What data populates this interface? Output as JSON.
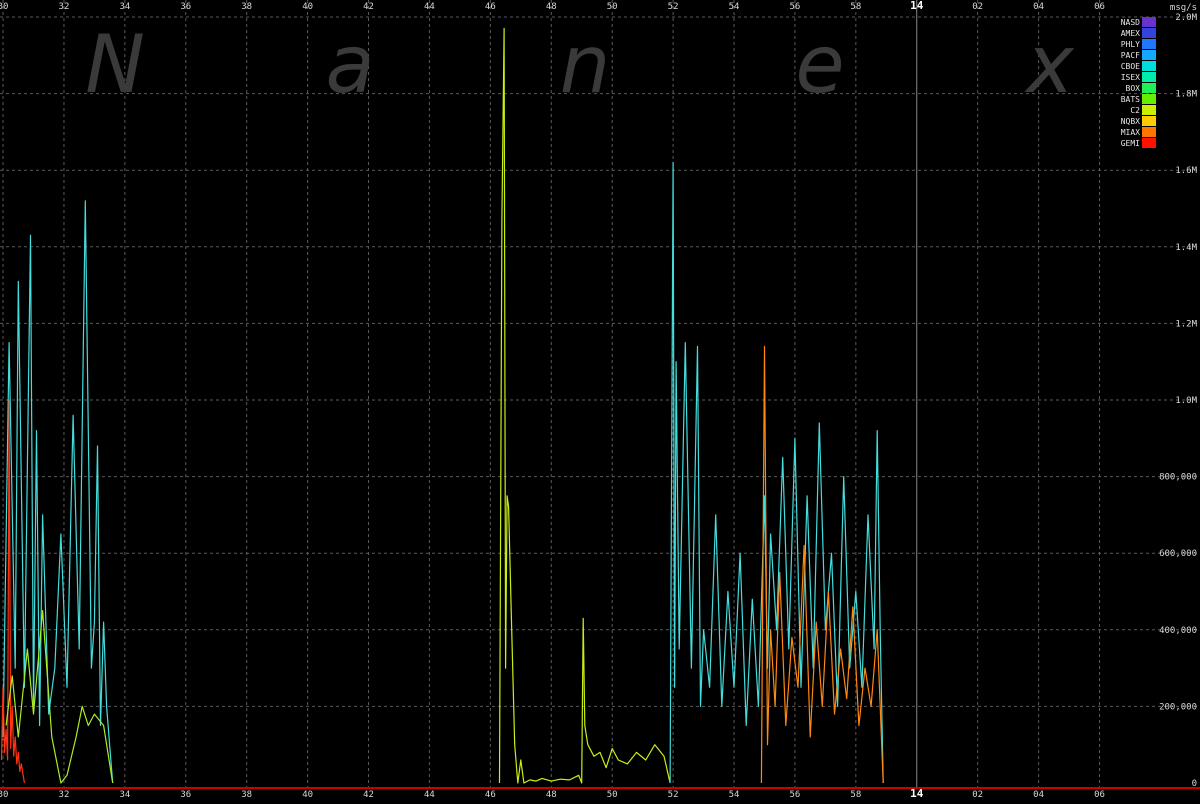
{
  "watermark": [
    "N",
    "a",
    "n",
    "e",
    "x"
  ],
  "chart_data": {
    "type": "line",
    "title": "",
    "xlabel": "",
    "ylabel": "msg/s",
    "xlim": [
      29.9,
      69.3
    ],
    "ylim": [
      0,
      2000000
    ],
    "grid": true,
    "legend_position": "top-right",
    "x_ticks": [
      {
        "value": 30,
        "label": "30"
      },
      {
        "value": 32,
        "label": "32"
      },
      {
        "value": 34,
        "label": "34"
      },
      {
        "value": 36,
        "label": "36"
      },
      {
        "value": 38,
        "label": "38"
      },
      {
        "value": 40,
        "label": "40"
      },
      {
        "value": 42,
        "label": "42"
      },
      {
        "value": 44,
        "label": "44"
      },
      {
        "value": 46,
        "label": "46"
      },
      {
        "value": 48,
        "label": "48"
      },
      {
        "value": 50,
        "label": "50"
      },
      {
        "value": 52,
        "label": "52"
      },
      {
        "value": 54,
        "label": "54"
      },
      {
        "value": 56,
        "label": "56"
      },
      {
        "value": 58,
        "label": "58"
      },
      {
        "value": 60,
        "label": "14",
        "hour": true
      },
      {
        "value": 62,
        "label": "02"
      },
      {
        "value": 64,
        "label": "04"
      },
      {
        "value": 66,
        "label": "06"
      }
    ],
    "y_ticks": [
      {
        "value": 0,
        "label": "0"
      },
      {
        "value": 200000,
        "label": "200,000"
      },
      {
        "value": 400000,
        "label": "400,000"
      },
      {
        "value": 600000,
        "label": "600,000"
      },
      {
        "value": 800000,
        "label": "800,000"
      },
      {
        "value": 1000000,
        "label": "1.0M"
      },
      {
        "value": 1200000,
        "label": "1.2M"
      },
      {
        "value": 1400000,
        "label": "1.4M"
      },
      {
        "value": 1600000,
        "label": "1.6M"
      },
      {
        "value": 1800000,
        "label": "1.8M"
      },
      {
        "value": 2000000,
        "label": "2.0M"
      }
    ],
    "legend": [
      {
        "name": "NASD",
        "color": "#6633cc"
      },
      {
        "name": "AMEX",
        "color": "#3344dd"
      },
      {
        "name": "PHLY",
        "color": "#2277ff"
      },
      {
        "name": "PACF",
        "color": "#11aaff"
      },
      {
        "name": "CBOE",
        "color": "#00dddd"
      },
      {
        "name": "ISEX",
        "color": "#00eeaa"
      },
      {
        "name": "BOX",
        "color": "#22ee55"
      },
      {
        "name": "BATS",
        "color": "#66ee00"
      },
      {
        "name": "C2",
        "color": "#ccee00"
      },
      {
        "name": "NQBX",
        "color": "#ffcc00"
      },
      {
        "name": "MIAX",
        "color": "#ff7700"
      },
      {
        "name": "GEMI",
        "color": "#ff1100"
      }
    ],
    "series": [
      {
        "color": "#44dddd",
        "x": [
          30.0,
          30.2,
          30.4,
          30.5,
          30.7,
          30.9,
          31.0,
          31.1,
          31.2,
          31.3,
          31.5,
          31.7,
          31.9,
          32.1,
          32.3,
          32.5,
          32.7,
          32.9,
          33.0,
          33.1,
          33.2,
          33.3,
          33.4,
          33.5,
          33.6
        ],
        "values": [
          120000,
          1150000,
          300000,
          1310000,
          250000,
          1430000,
          200000,
          920000,
          150000,
          700000,
          180000,
          300000,
          650000,
          250000,
          960000,
          350000,
          1520000,
          300000,
          420000,
          880000,
          150000,
          420000,
          200000,
          100000,
          0
        ]
      },
      {
        "color": "#ff3311",
        "x": [
          29.95,
          30.0,
          30.05,
          30.1,
          30.15,
          30.2,
          30.25,
          30.3,
          30.35,
          30.4,
          30.45,
          30.5,
          30.55,
          30.6,
          30.7
        ],
        "values": [
          60000,
          250000,
          80000,
          140000,
          60000,
          1000000,
          90000,
          200000,
          70000,
          120000,
          50000,
          80000,
          30000,
          50000,
          0
        ]
      },
      {
        "color": "#aaee22",
        "x": [
          30.1,
          30.3,
          30.5,
          30.8,
          31.0,
          31.3,
          31.6,
          31.9,
          32.1,
          32.4,
          32.6,
          32.8,
          33.0,
          33.3,
          33.6
        ],
        "values": [
          150000,
          280000,
          120000,
          350000,
          180000,
          450000,
          120000,
          0,
          20000,
          120000,
          200000,
          150000,
          180000,
          150000,
          0
        ]
      },
      {
        "color": "#ccee11",
        "x": [
          46.3,
          46.38,
          46.45,
          46.5,
          46.55,
          46.6,
          46.7,
          46.8,
          46.9,
          47.0,
          47.1,
          47.3,
          47.5,
          47.7,
          48.0,
          48.3,
          48.6,
          48.9,
          49.0,
          49.05,
          49.1,
          49.2,
          49.4,
          49.6,
          49.8,
          50.0,
          50.2,
          50.5,
          50.8,
          51.1,
          51.4,
          51.7,
          51.9
        ],
        "values": [
          0,
          1470000,
          1970000,
          300000,
          750000,
          720000,
          400000,
          100000,
          0,
          60000,
          0,
          8000,
          5000,
          12000,
          5000,
          10000,
          8000,
          20000,
          0,
          430000,
          150000,
          100000,
          70000,
          80000,
          40000,
          90000,
          60000,
          50000,
          80000,
          60000,
          100000,
          70000,
          0
        ]
      },
      {
        "color": "#44dddd",
        "x": [
          51.9,
          52.0,
          52.05,
          52.1,
          52.2,
          52.4,
          52.6,
          52.8,
          52.9,
          53.0,
          53.2,
          53.4,
          53.6,
          53.8,
          54.0,
          54.2,
          54.4,
          54.6,
          54.8,
          55.0,
          55.1,
          55.2,
          55.4,
          55.6,
          55.8,
          56.0,
          56.2,
          56.4,
          56.6,
          56.8,
          57.0,
          57.2,
          57.4,
          57.6,
          57.8,
          58.0,
          58.2,
          58.4,
          58.6,
          58.7,
          58.8,
          58.9
        ],
        "values": [
          0,
          1620000,
          250000,
          1100000,
          350000,
          1150000,
          300000,
          1140000,
          200000,
          400000,
          250000,
          700000,
          200000,
          500000,
          250000,
          600000,
          150000,
          480000,
          200000,
          750000,
          300000,
          650000,
          400000,
          850000,
          350000,
          900000,
          250000,
          750000,
          300000,
          940000,
          400000,
          600000,
          200000,
          800000,
          300000,
          500000,
          250000,
          700000,
          350000,
          920000,
          400000,
          0
        ]
      },
      {
        "color": "#ff8811",
        "x": [
          54.9,
          55.0,
          55.1,
          55.2,
          55.35,
          55.5,
          55.7,
          55.9,
          56.1,
          56.3,
          56.5,
          56.7,
          56.9,
          57.1,
          57.3,
          57.5,
          57.7,
          57.9,
          58.1,
          58.3,
          58.5,
          58.7,
          58.9
        ],
        "values": [
          0,
          1140000,
          100000,
          400000,
          200000,
          550000,
          150000,
          380000,
          250000,
          620000,
          120000,
          420000,
          200000,
          500000,
          180000,
          350000,
          220000,
          460000,
          150000,
          300000,
          200000,
          400000,
          0
        ]
      }
    ]
  }
}
